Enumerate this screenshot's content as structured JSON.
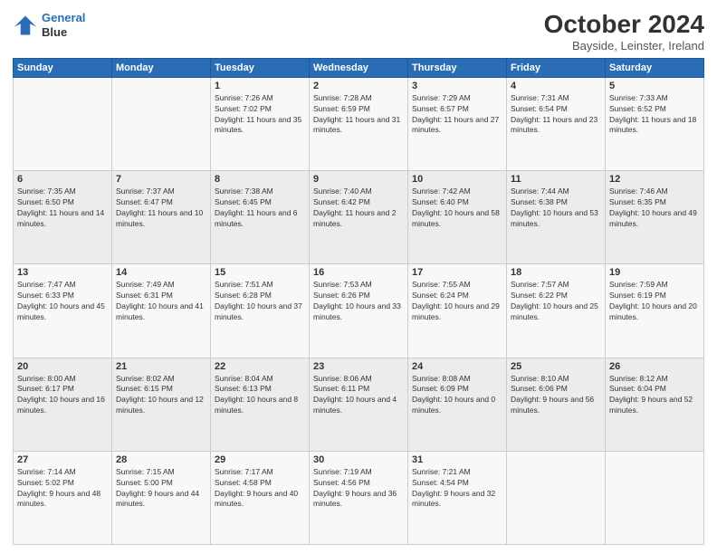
{
  "logo": {
    "line1": "General",
    "line2": "Blue"
  },
  "title": "October 2024",
  "subtitle": "Bayside, Leinster, Ireland",
  "days_of_week": [
    "Sunday",
    "Monday",
    "Tuesday",
    "Wednesday",
    "Thursday",
    "Friday",
    "Saturday"
  ],
  "weeks": [
    [
      {
        "day": "",
        "info": ""
      },
      {
        "day": "",
        "info": ""
      },
      {
        "day": "1",
        "info": "Sunrise: 7:26 AM\nSunset: 7:02 PM\nDaylight: 11 hours and 35 minutes."
      },
      {
        "day": "2",
        "info": "Sunrise: 7:28 AM\nSunset: 6:59 PM\nDaylight: 11 hours and 31 minutes."
      },
      {
        "day": "3",
        "info": "Sunrise: 7:29 AM\nSunset: 6:57 PM\nDaylight: 11 hours and 27 minutes."
      },
      {
        "day": "4",
        "info": "Sunrise: 7:31 AM\nSunset: 6:54 PM\nDaylight: 11 hours and 23 minutes."
      },
      {
        "day": "5",
        "info": "Sunrise: 7:33 AM\nSunset: 6:52 PM\nDaylight: 11 hours and 18 minutes."
      }
    ],
    [
      {
        "day": "6",
        "info": "Sunrise: 7:35 AM\nSunset: 6:50 PM\nDaylight: 11 hours and 14 minutes."
      },
      {
        "day": "7",
        "info": "Sunrise: 7:37 AM\nSunset: 6:47 PM\nDaylight: 11 hours and 10 minutes."
      },
      {
        "day": "8",
        "info": "Sunrise: 7:38 AM\nSunset: 6:45 PM\nDaylight: 11 hours and 6 minutes."
      },
      {
        "day": "9",
        "info": "Sunrise: 7:40 AM\nSunset: 6:42 PM\nDaylight: 11 hours and 2 minutes."
      },
      {
        "day": "10",
        "info": "Sunrise: 7:42 AM\nSunset: 6:40 PM\nDaylight: 10 hours and 58 minutes."
      },
      {
        "day": "11",
        "info": "Sunrise: 7:44 AM\nSunset: 6:38 PM\nDaylight: 10 hours and 53 minutes."
      },
      {
        "day": "12",
        "info": "Sunrise: 7:46 AM\nSunset: 6:35 PM\nDaylight: 10 hours and 49 minutes."
      }
    ],
    [
      {
        "day": "13",
        "info": "Sunrise: 7:47 AM\nSunset: 6:33 PM\nDaylight: 10 hours and 45 minutes."
      },
      {
        "day": "14",
        "info": "Sunrise: 7:49 AM\nSunset: 6:31 PM\nDaylight: 10 hours and 41 minutes."
      },
      {
        "day": "15",
        "info": "Sunrise: 7:51 AM\nSunset: 6:28 PM\nDaylight: 10 hours and 37 minutes."
      },
      {
        "day": "16",
        "info": "Sunrise: 7:53 AM\nSunset: 6:26 PM\nDaylight: 10 hours and 33 minutes."
      },
      {
        "day": "17",
        "info": "Sunrise: 7:55 AM\nSunset: 6:24 PM\nDaylight: 10 hours and 29 minutes."
      },
      {
        "day": "18",
        "info": "Sunrise: 7:57 AM\nSunset: 6:22 PM\nDaylight: 10 hours and 25 minutes."
      },
      {
        "day": "19",
        "info": "Sunrise: 7:59 AM\nSunset: 6:19 PM\nDaylight: 10 hours and 20 minutes."
      }
    ],
    [
      {
        "day": "20",
        "info": "Sunrise: 8:00 AM\nSunset: 6:17 PM\nDaylight: 10 hours and 16 minutes."
      },
      {
        "day": "21",
        "info": "Sunrise: 8:02 AM\nSunset: 6:15 PM\nDaylight: 10 hours and 12 minutes."
      },
      {
        "day": "22",
        "info": "Sunrise: 8:04 AM\nSunset: 6:13 PM\nDaylight: 10 hours and 8 minutes."
      },
      {
        "day": "23",
        "info": "Sunrise: 8:06 AM\nSunset: 6:11 PM\nDaylight: 10 hours and 4 minutes."
      },
      {
        "day": "24",
        "info": "Sunrise: 8:08 AM\nSunset: 6:09 PM\nDaylight: 10 hours and 0 minutes."
      },
      {
        "day": "25",
        "info": "Sunrise: 8:10 AM\nSunset: 6:06 PM\nDaylight: 9 hours and 56 minutes."
      },
      {
        "day": "26",
        "info": "Sunrise: 8:12 AM\nSunset: 6:04 PM\nDaylight: 9 hours and 52 minutes."
      }
    ],
    [
      {
        "day": "27",
        "info": "Sunrise: 7:14 AM\nSunset: 5:02 PM\nDaylight: 9 hours and 48 minutes."
      },
      {
        "day": "28",
        "info": "Sunrise: 7:15 AM\nSunset: 5:00 PM\nDaylight: 9 hours and 44 minutes."
      },
      {
        "day": "29",
        "info": "Sunrise: 7:17 AM\nSunset: 4:58 PM\nDaylight: 9 hours and 40 minutes."
      },
      {
        "day": "30",
        "info": "Sunrise: 7:19 AM\nSunset: 4:56 PM\nDaylight: 9 hours and 36 minutes."
      },
      {
        "day": "31",
        "info": "Sunrise: 7:21 AM\nSunset: 4:54 PM\nDaylight: 9 hours and 32 minutes."
      },
      {
        "day": "",
        "info": ""
      },
      {
        "day": "",
        "info": ""
      }
    ]
  ]
}
